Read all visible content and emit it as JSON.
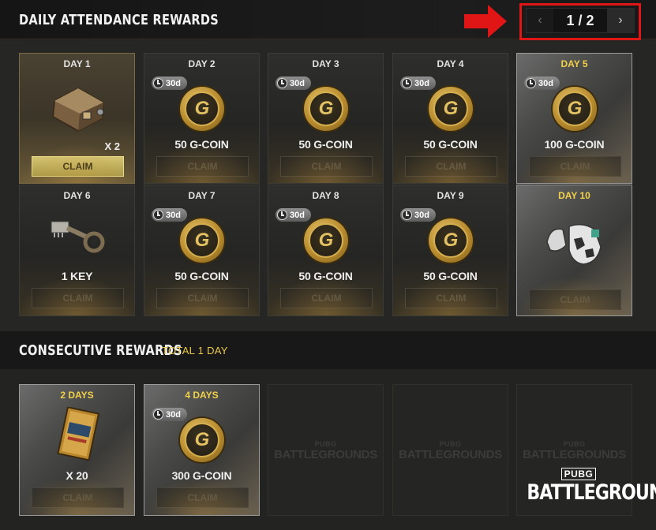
{
  "header": {
    "title": "DAILY ATTENDANCE REWARDS",
    "pager": {
      "prev_icon": "chevron-left-icon",
      "next_icon": "chevron-right-icon",
      "text": "1 / 2",
      "prev": "‹",
      "next": "›"
    },
    "callout_color": "#e01515"
  },
  "daily": [
    {
      "day": "DAY 1",
      "item": "crate",
      "quantity": "X 2",
      "claim": "CLAIM",
      "claimable": true,
      "timer": ""
    },
    {
      "day": "DAY 2",
      "item": "g-coin",
      "reward": "50 G-COIN",
      "claim": "CLAIM",
      "timer": "30d"
    },
    {
      "day": "DAY 3",
      "item": "g-coin",
      "reward": "50 G-COIN",
      "claim": "CLAIM",
      "timer": "30d"
    },
    {
      "day": "DAY 4",
      "item": "g-coin",
      "reward": "50 G-COIN",
      "claim": "CLAIM",
      "timer": "30d"
    },
    {
      "day": "DAY 5",
      "item": "g-coin",
      "reward": "100 G-COIN",
      "claim": "CLAIM",
      "timer": "30d",
      "highlight": true
    },
    {
      "day": "DAY 6",
      "item": "key",
      "reward": "1 KEY",
      "claim": "CLAIM",
      "timer": ""
    },
    {
      "day": "DAY 7",
      "item": "g-coin",
      "reward": "50 G-COIN",
      "claim": "CLAIM",
      "timer": "30d"
    },
    {
      "day": "DAY 8",
      "item": "g-coin",
      "reward": "50 G-COIN",
      "claim": "CLAIM",
      "timer": "30d"
    },
    {
      "day": "DAY 9",
      "item": "g-coin",
      "reward": "50 G-COIN",
      "claim": "CLAIM",
      "timer": "30d"
    },
    {
      "day": "DAY 10",
      "item": "gloves",
      "reward": "",
      "claim": "CLAIM",
      "timer": "",
      "highlight": true
    }
  ],
  "consecutive": {
    "title": "CONSECUTIVE REWARDS",
    "total": "TOTAL 1 DAY",
    "items": [
      {
        "days": "2 DAYS",
        "item": "coupon",
        "reward": "X 20",
        "claim": "CLAIM",
        "timer": ""
      },
      {
        "days": "4 DAYS",
        "item": "g-coin",
        "reward": "300 G-COIN",
        "claim": "CLAIM",
        "timer": "30d"
      }
    ],
    "placeholder_small": "PUBG",
    "placeholder_big": "BATTLEGROUNDS"
  },
  "coin_glyph": "G",
  "brand": {
    "small": "PUBG",
    "big": "BATTLEGROUNDS"
  }
}
